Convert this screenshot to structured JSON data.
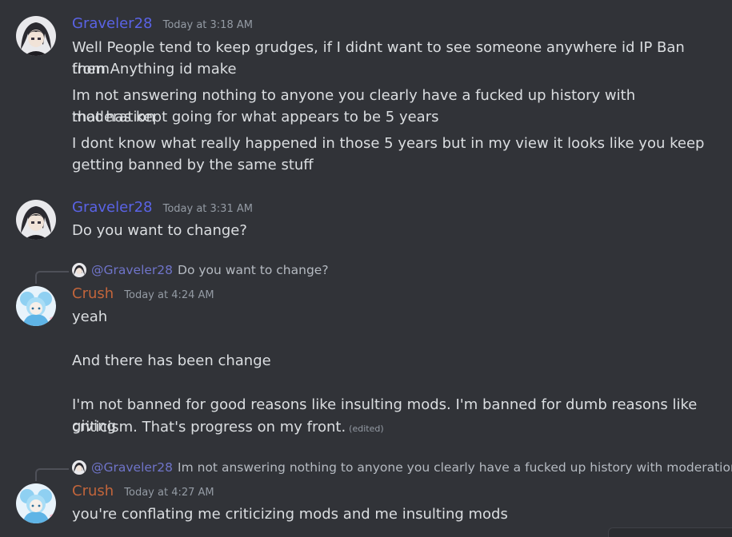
{
  "groups": [
    {
      "username": "Graveler28",
      "timestamp": "Today at 3:18 AM",
      "lines": [
        "Well People tend to keep grudges, if I didnt want to see someone anywhere id IP Ban them",
        "from Anything id make",
        "Im not answering nothing to anyone you clearly have a fucked up history with moderation",
        "that has kept going for what appears to be 5 years",
        "I dont know what really happened in those 5 years but in my view it looks like you keep",
        "getting banned by the same stuff"
      ]
    },
    {
      "username": "Graveler28",
      "timestamp": "Today at 3:31 AM",
      "lines": [
        "Do you want to change?"
      ]
    },
    {
      "reply": {
        "mention": "@Graveler28",
        "text": "Do you want to change?"
      },
      "username": "Crush",
      "timestamp": "Today at 4:24 AM",
      "lines": [
        "yeah",
        "And there has been change",
        "I'm not banned for good reasons like insulting mods. I'm banned for dumb reasons like giving",
        "criticism. That's progress on my front."
      ],
      "edited": "(edited)"
    },
    {
      "reply": {
        "mention": "@Graveler28",
        "text": "Im not answering nothing to anyone you clearly have a fucked up history with moderation"
      },
      "username": "Crush",
      "timestamp": "Today at 4:27 AM",
      "lines": [
        "you're conflating me criticizing mods and me insulting mods"
      ]
    }
  ],
  "colors": {
    "background": "#313338",
    "graveler_name": "#5a63e6",
    "crush_name": "#c2653b",
    "text": "#dbdee1",
    "muted": "#949ba4"
  },
  "icons": {
    "graveler_avatar": "dark-haired-anime-avatar",
    "crush_avatar": "light-blue-anime-avatar"
  }
}
